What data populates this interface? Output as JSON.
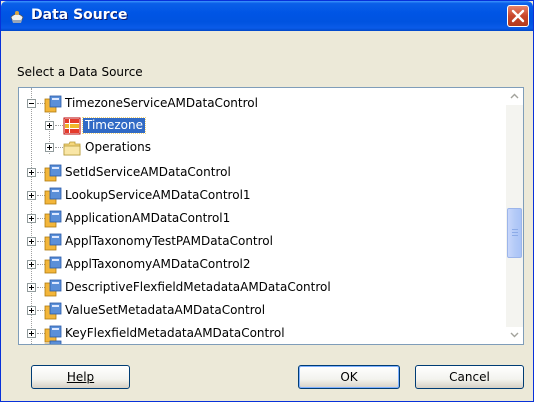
{
  "window": {
    "title": "Data Source"
  },
  "prompt": "Select a Data Source",
  "tree": {
    "items": [
      {
        "label": "TimezoneServiceAMDataControl",
        "expanded": true,
        "level": 0
      },
      {
        "label": "Timezone",
        "level": 1,
        "selected": true,
        "icon": "table-collection-icon"
      },
      {
        "label": "Operations",
        "level": 1,
        "icon": "folder-icon"
      },
      {
        "label": "SetIdServiceAMDataControl",
        "level": 0
      },
      {
        "label": "LookupServiceAMDataControl1",
        "level": 0
      },
      {
        "label": "ApplicationAMDataControl1",
        "level": 0
      },
      {
        "label": "ApplTaxonomyTestPAMDataControl",
        "level": 0
      },
      {
        "label": "ApplTaxonomyAMDataControl2",
        "level": 0
      },
      {
        "label": "DescriptiveFlexfieldMetadataAMDataControl",
        "level": 0
      },
      {
        "label": "ValueSetMetadataAMDataControl",
        "level": 0
      },
      {
        "label": "KeyFlexfieldMetadataAMDataControl",
        "level": 0
      }
    ]
  },
  "buttons": {
    "help": "Help",
    "ok": "OK",
    "cancel": "Cancel"
  },
  "colors": {
    "titlebar": "#0055e5",
    "selection": "#316ac5",
    "window_bg": "#ece9d8"
  }
}
